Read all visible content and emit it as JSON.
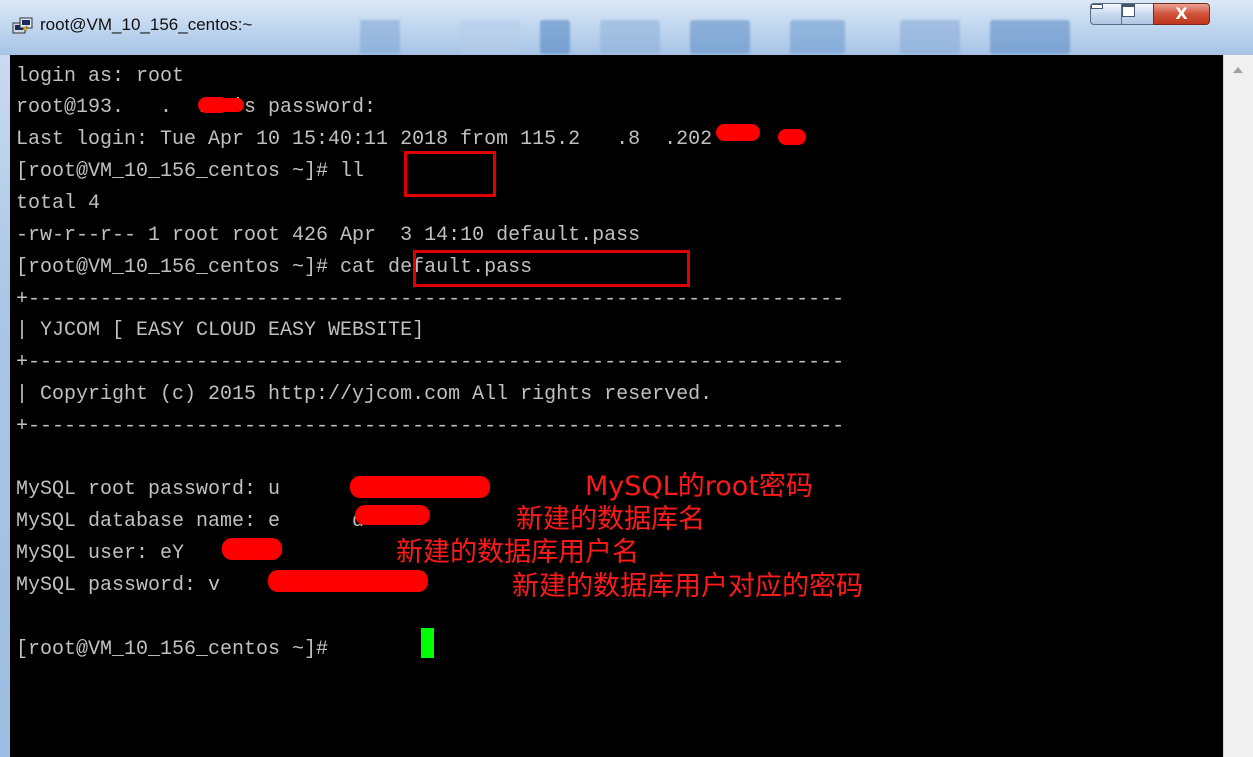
{
  "window": {
    "title": "root@VM_10_156_centos:~",
    "close_label": "X"
  },
  "terminal": {
    "lines": [
      "login as: root",
      "root@193.   .  .60's password:",
      "Last login: Tue Apr 10 15:40:11 2018 from 115.2   .8  .202",
      "[root@VM_10_156_centos ~]# ll",
      "total 4",
      "-rw-r--r-- 1 root root 426 Apr  3 14:10 default.pass",
      "[root@VM_10_156_centos ~]# cat default.pass",
      "+--------------------------------------------------------------------",
      "| YJCOM [ EASY CLOUD EASY WEBSITE]",
      "+--------------------------------------------------------------------",
      "| Copyright (c) 2015 http://yjcom.com All rights reserved.",
      "+--------------------------------------------------------------------",
      "",
      "MySQL root password: u          Q",
      "MySQL database name: e      d",
      "MySQL user: eY",
      "MySQL password: v",
      "",
      "[root@VM_10_156_centos ~]# "
    ]
  },
  "annotations": {
    "root_password": "MySQL的root密码",
    "database_name": "新建的数据库名",
    "user": "新建的数据库用户名",
    "password": "新建的数据库用户对应的密码"
  },
  "colors": {
    "terminal_bg": "#000000",
    "terminal_fg": "#c0c0c0",
    "highlight": "#e00000",
    "cursor": "#00ff00",
    "annotation": "#ff1a1a"
  }
}
